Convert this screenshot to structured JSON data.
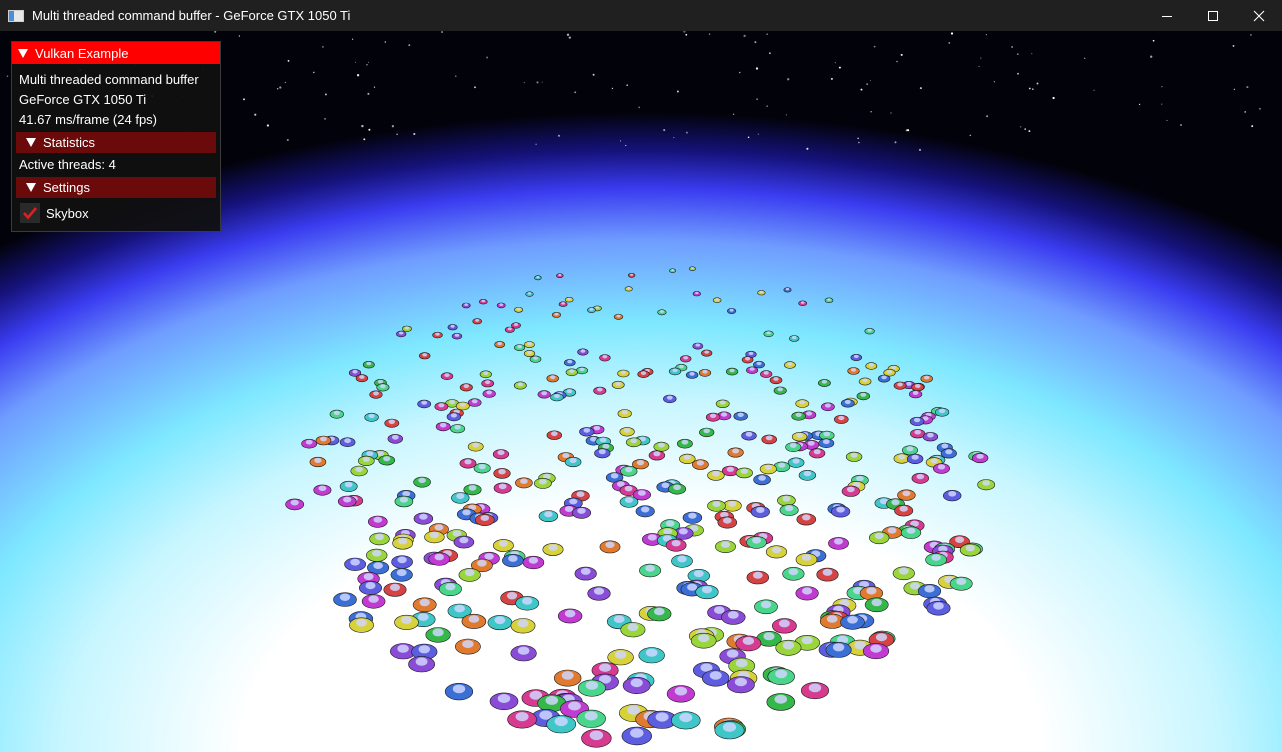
{
  "window": {
    "title": "Multi threaded command buffer - GeForce GTX 1050 Ti"
  },
  "overlay": {
    "header": "Vulkan Example",
    "app_name": "Multi threaded command buffer",
    "device": "GeForce GTX 1050 Ti",
    "frame_time": "41.67 ms/frame (24 fps)",
    "statistics": {
      "header": "Statistics",
      "active_threads": "Active threads: 4"
    },
    "settings": {
      "header": "Settings",
      "skybox_label": "Skybox",
      "skybox_checked": true
    }
  },
  "colors": {
    "header_red": "#ff0000",
    "section_red": "#6b0a0a",
    "check_red": "#e01e1e",
    "titlebar": "#202020"
  },
  "icons": {
    "app": "app-window-icon",
    "minimize": "minimize-icon",
    "maximize": "maximize-icon",
    "close": "close-icon",
    "collapse": "triangle-down-icon",
    "check": "checkmark-icon"
  }
}
